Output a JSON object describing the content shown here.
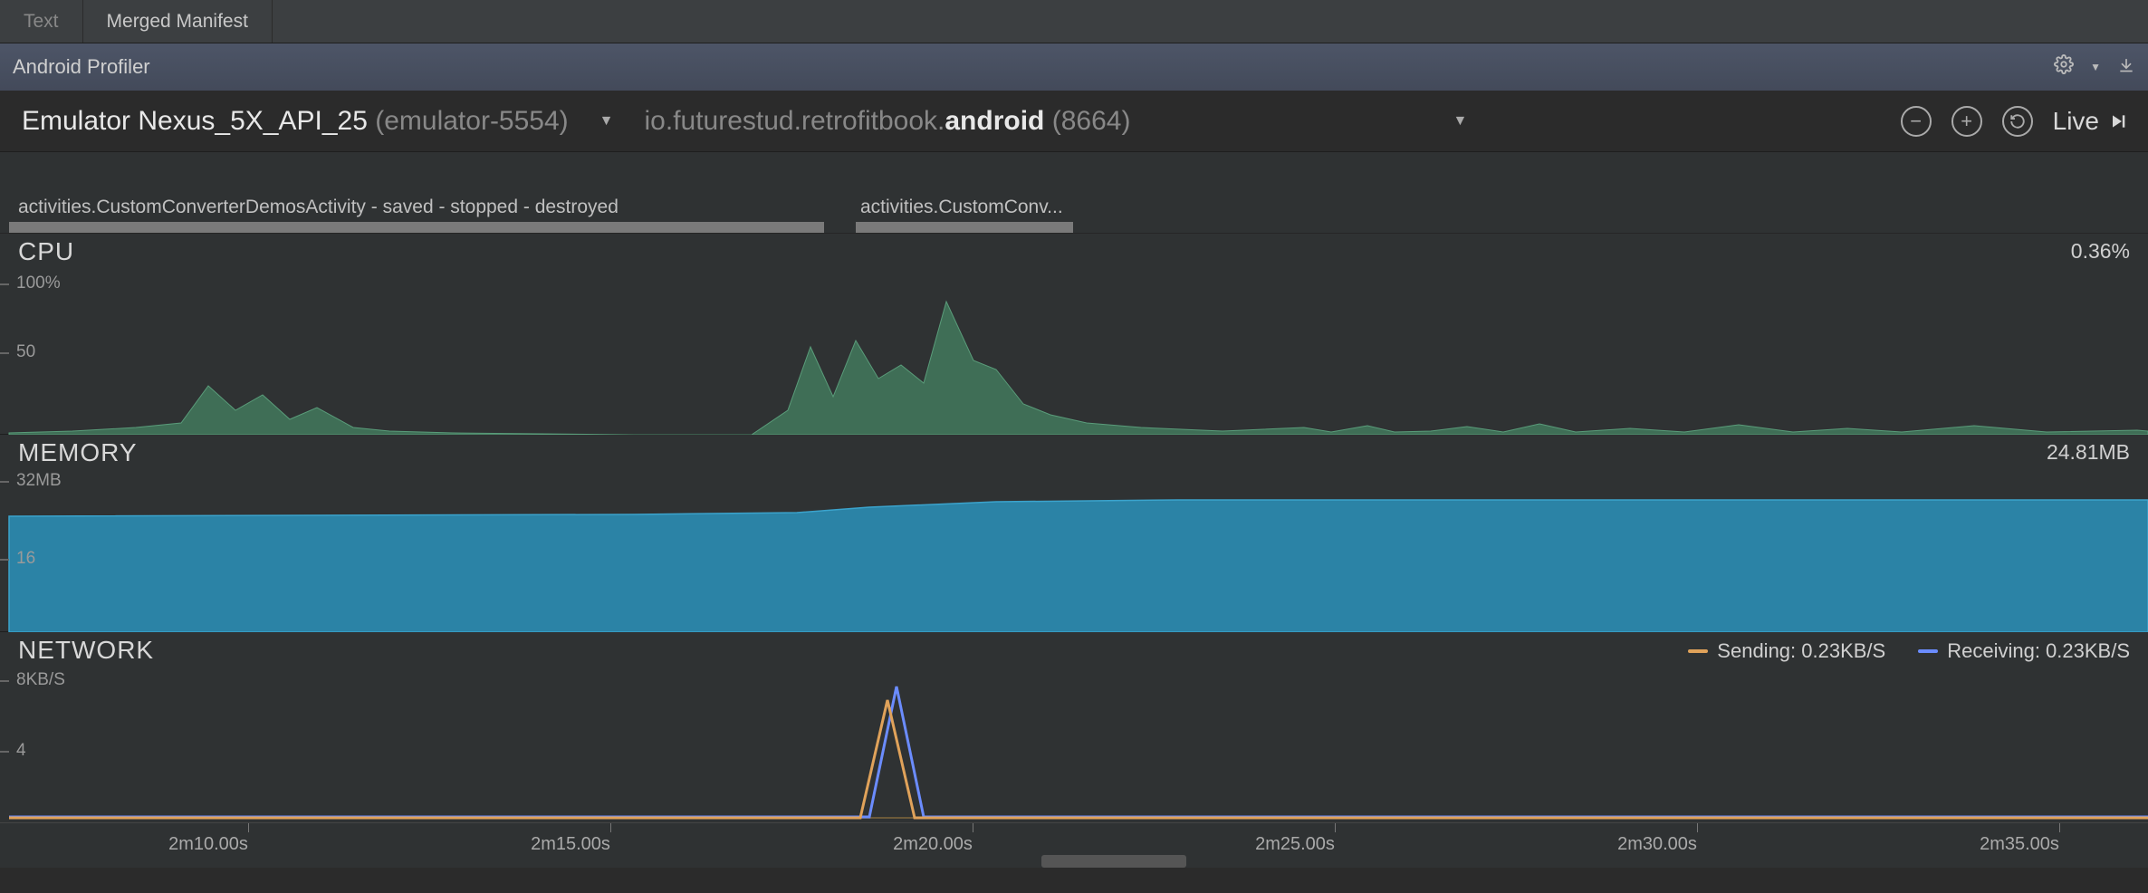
{
  "tabs": {
    "text": "Text",
    "merged": "Merged Manifest"
  },
  "profiler_title": "Android Profiler",
  "device": {
    "name": "Emulator Nexus_5X_API_25",
    "serial": "(emulator-5554)",
    "package_prefix": "io.futurestud.retrofitbook.",
    "package_bold": "android",
    "pid": "(8664)"
  },
  "live_label": "Live",
  "activities": {
    "left_label": "activities.CustomConverterDemosActivity - saved - stopped - destroyed",
    "right_label": "activities.CustomConv..."
  },
  "cpu": {
    "title": "CPU",
    "value": "0.36%",
    "yticks": [
      "100%",
      "50"
    ]
  },
  "memory": {
    "title": "MEMORY",
    "value": "24.81MB",
    "yticks": [
      "32MB",
      "16"
    ]
  },
  "network": {
    "title": "NETWORK",
    "yticks": [
      "8KB/S",
      "4"
    ],
    "legend": {
      "sending_label": "Sending: 0.23KB/S",
      "sending_color": "#e0a25a",
      "receiving_label": "Receiving: 0.23KB/S",
      "receiving_color": "#6b8cff"
    }
  },
  "time_ticks": [
    "2m10.00s",
    "2m15.00s",
    "2m20.00s",
    "2m25.00s",
    "2m30.00s",
    "2m35.00s"
  ],
  "chart_data": [
    {
      "type": "area",
      "title": "CPU",
      "ylabel": "%",
      "ylim": [
        0,
        100
      ],
      "x_range_seconds": [
        127,
        158
      ],
      "series": [
        {
          "name": "cpu",
          "x": [
            127,
            128,
            129,
            130,
            131,
            131.5,
            132,
            132.5,
            133,
            133.5,
            134,
            134.5,
            135,
            135.5,
            136,
            137,
            138,
            138.5,
            139,
            139.5,
            140,
            140.5,
            141,
            141.5,
            142,
            142.5,
            143,
            143.5,
            144,
            144.5,
            145,
            146,
            147,
            148,
            148.5,
            149,
            149.5,
            150,
            150.5,
            151,
            151.5,
            152,
            153,
            154,
            155,
            156,
            157,
            158
          ],
          "values": [
            0,
            0,
            4,
            8,
            3,
            30,
            15,
            25,
            10,
            18,
            5,
            3,
            2,
            1,
            0,
            0,
            15,
            55,
            25,
            60,
            35,
            45,
            30,
            85,
            45,
            40,
            20,
            10,
            8,
            6,
            4,
            3,
            2,
            4,
            2,
            6,
            2,
            3,
            5,
            2,
            8,
            2,
            4,
            2,
            6,
            2,
            3,
            2
          ]
        }
      ]
    },
    {
      "type": "area",
      "title": "MEMORY",
      "ylabel": "MB",
      "ylim": [
        0,
        32
      ],
      "x_range_seconds": [
        127,
        158
      ],
      "series": [
        {
          "name": "memory",
          "x": [
            127,
            138,
            140,
            145,
            158
          ],
          "values": [
            22.5,
            22.7,
            23.5,
            24.8,
            24.8
          ]
        }
      ]
    },
    {
      "type": "line",
      "title": "NETWORK",
      "ylabel": "KB/S",
      "ylim": [
        0,
        8
      ],
      "x_range_seconds": [
        127,
        158
      ],
      "series": [
        {
          "name": "Sending",
          "color": "#e0a25a",
          "x": [
            127,
            139.2,
            139.8,
            140.4,
            141.2,
            158
          ],
          "values": [
            0.2,
            0.2,
            6.0,
            0.2,
            0.2,
            0.23
          ]
        },
        {
          "name": "Receiving",
          "color": "#6b8cff",
          "x": [
            127,
            139.4,
            140.0,
            140.6,
            141.4,
            158
          ],
          "values": [
            0.2,
            0.2,
            6.8,
            0.2,
            0.2,
            0.23
          ]
        }
      ]
    }
  ]
}
